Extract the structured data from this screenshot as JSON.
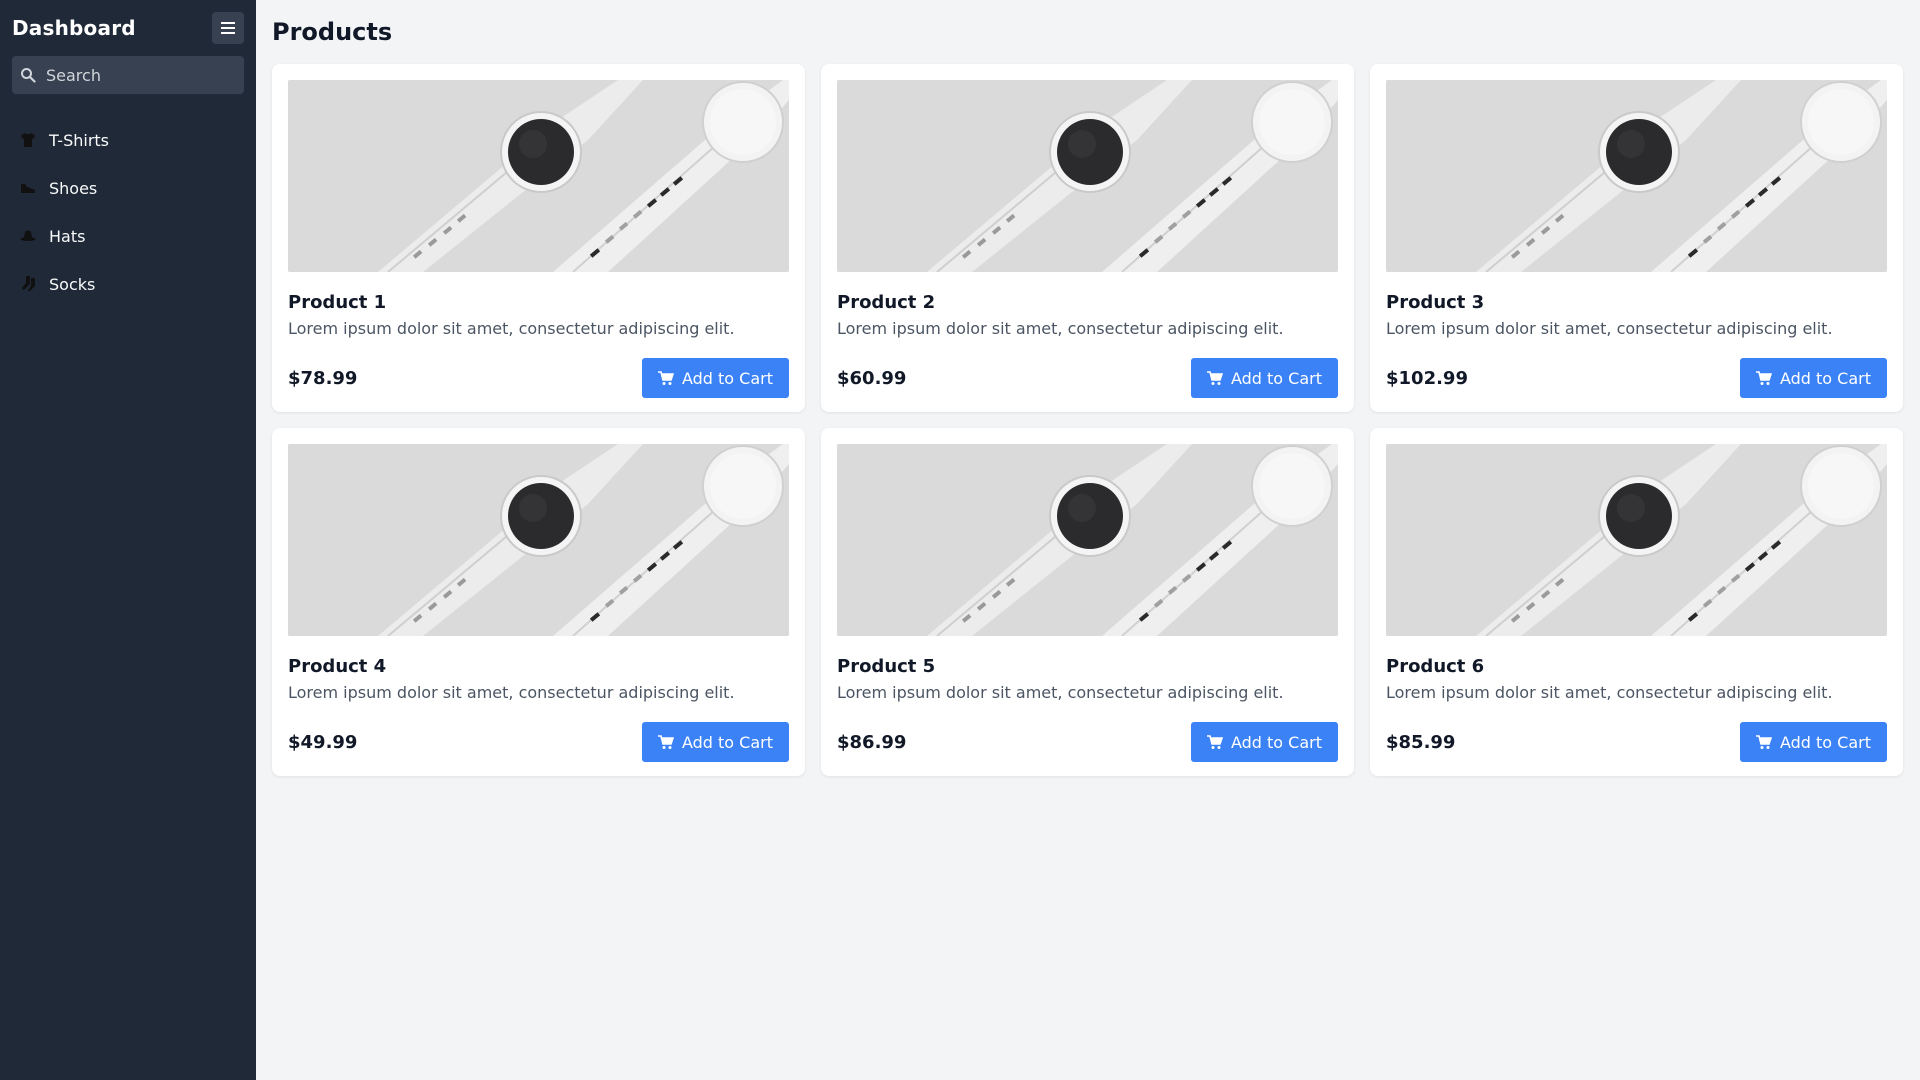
{
  "sidebar": {
    "title": "Dashboard",
    "search_placeholder": "Search",
    "items": [
      {
        "label": "T-Shirts",
        "icon": "tshirt-icon"
      },
      {
        "label": "Shoes",
        "icon": "shoe-icon"
      },
      {
        "label": "Hats",
        "icon": "hat-icon"
      },
      {
        "label": "Socks",
        "icon": "socks-icon"
      }
    ]
  },
  "main": {
    "title": "Products",
    "products": [
      {
        "name": "Product 1",
        "description": "Lorem ipsum dolor sit amet, consectetur adipiscing elit.",
        "price": "$78.99",
        "button": "Add to Cart"
      },
      {
        "name": "Product 2",
        "description": "Lorem ipsum dolor sit amet, consectetur adipiscing elit.",
        "price": "$60.99",
        "button": "Add to Cart"
      },
      {
        "name": "Product 3",
        "description": "Lorem ipsum dolor sit amet, consectetur adipiscing elit.",
        "price": "$102.99",
        "button": "Add to Cart"
      },
      {
        "name": "Product 4",
        "description": "Lorem ipsum dolor sit amet, consectetur adipiscing elit.",
        "price": "$49.99",
        "button": "Add to Cart"
      },
      {
        "name": "Product 5",
        "description": "Lorem ipsum dolor sit amet, consectetur adipiscing elit.",
        "price": "$86.99",
        "button": "Add to Cart"
      },
      {
        "name": "Product 6",
        "description": "Lorem ipsum dolor sit amet, consectetur adipiscing elit.",
        "price": "$85.99",
        "button": "Add to Cart"
      }
    ]
  },
  "colors": {
    "sidebar_bg": "#1f2937",
    "accent": "#3b82f6",
    "page_bg": "#f3f4f6"
  }
}
